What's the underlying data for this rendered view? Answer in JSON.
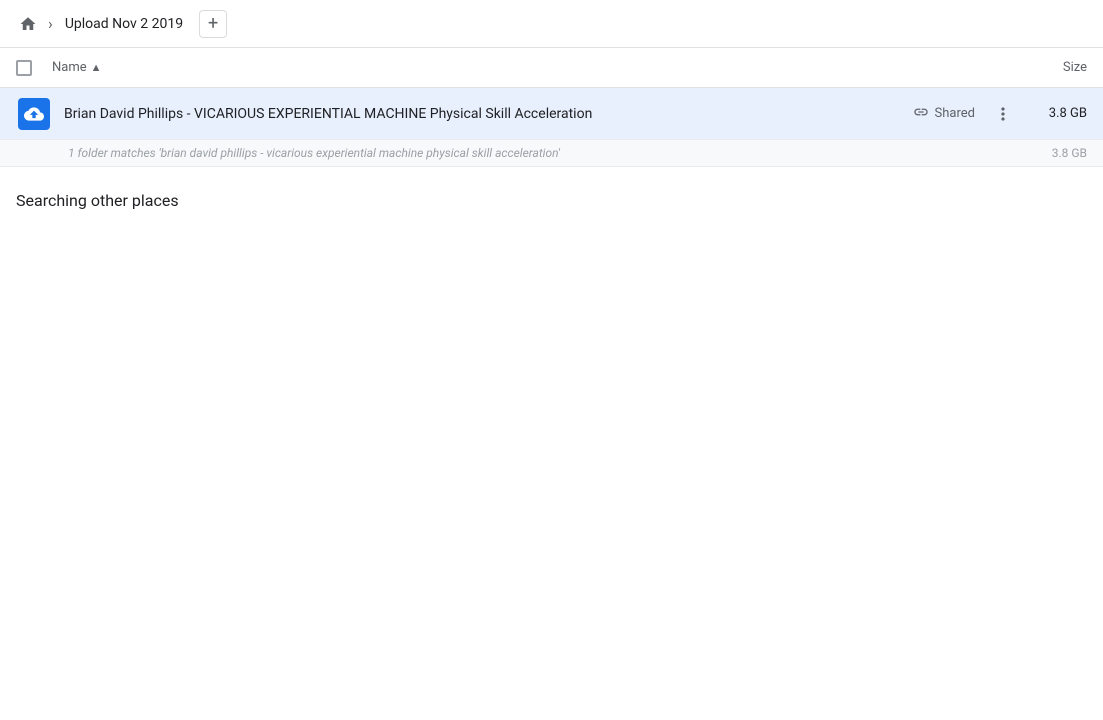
{
  "header": {
    "home_title": "Upload Nov 2 2019",
    "add_button_label": "+",
    "breadcrumb_separator": "›"
  },
  "columns": {
    "name_label": "Name",
    "sort_indicator": "▲",
    "size_label": "Size"
  },
  "file_row": {
    "name": "Brian David Phillips - VICARIOUS EXPERIENTIAL MACHINE Physical Skill Acceleration",
    "shared_label": "Shared",
    "size": "3.8 GB",
    "more_options_label": "···"
  },
  "match_row": {
    "text": "1 folder matches 'brian david phillips - vicarious experiential machine physical skill acceleration'",
    "size": "3.8 GB"
  },
  "searching": {
    "label": "Searching other places"
  }
}
